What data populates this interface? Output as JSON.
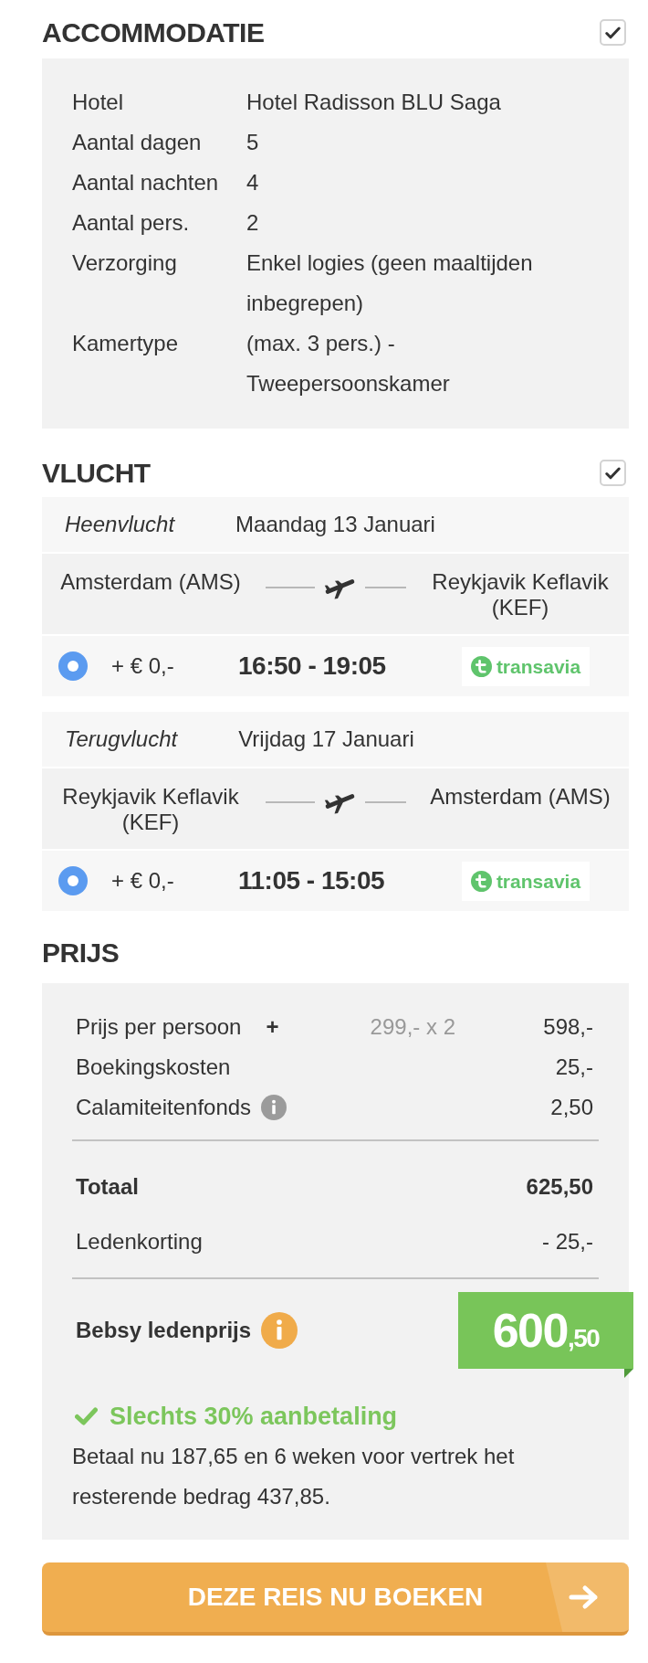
{
  "accommodation": {
    "heading": "ACCOMMODATIE",
    "checked": true,
    "details": [
      {
        "label": "Hotel",
        "value": "Hotel Radisson BLU Saga"
      },
      {
        "label": "Aantal dagen",
        "value": "5"
      },
      {
        "label": "Aantal nachten",
        "value": "4"
      },
      {
        "label": "Aantal pers.",
        "value": "2"
      },
      {
        "label": "Verzorging",
        "value": "Enkel logies (geen maaltijden inbegrepen)"
      },
      {
        "label": "Kamertype",
        "value": "(max. 3 pers.) - Tweepersoonskamer"
      }
    ]
  },
  "flight": {
    "heading": "VLUCHT",
    "checked": true,
    "legs": [
      {
        "direction": "Heenvlucht",
        "date": "Maandag 13 Januari",
        "from": "Amsterdam (AMS)",
        "to": "Reykjavik Keflavik (KEF)",
        "option": {
          "selected": true,
          "surcharge": "+ € 0,-",
          "times": "16:50 - 19:05",
          "airline": "transavia"
        }
      },
      {
        "direction": "Terugvlucht",
        "date": "Vrijdag 17 Januari",
        "from": "Reykjavik Keflavik (KEF)",
        "to": "Amsterdam (AMS)",
        "option": {
          "selected": true,
          "surcharge": "+ € 0,-",
          "times": "11:05 - 15:05",
          "airline": "transavia"
        }
      }
    ]
  },
  "price": {
    "heading": "PRIJS",
    "rows": [
      {
        "label": "Prijs per persoon",
        "toggle": "+",
        "calculation": "299,- x 2",
        "amount": "598,-",
        "info": false
      },
      {
        "label": "Boekingskosten",
        "amount": "25,-",
        "info": false
      },
      {
        "label": "Calamiteitenfonds",
        "amount": "2,50",
        "info": true
      }
    ],
    "total": {
      "label": "Totaal",
      "amount": "625,50"
    },
    "discount": {
      "label": "Ledenkorting",
      "amount": "- 25,-"
    },
    "member_price": {
      "label": "Bebsy ledenprijs",
      "amount": "600",
      "cents": ",50"
    },
    "deposit": {
      "title": "Slechts 30% aanbetaling",
      "text": "Betaal nu 187,65 en 6 weken voor vertrek het resterende bedrag 437,85."
    }
  },
  "book_button": {
    "label": "DEZE REIS NU BOEKEN"
  }
}
